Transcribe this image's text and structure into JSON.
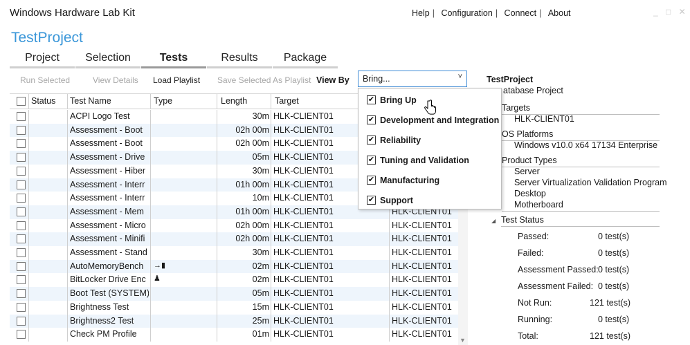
{
  "app": {
    "title": "Windows Hardware Lab Kit",
    "links": [
      "Help",
      "Configuration",
      "Connect",
      "About"
    ],
    "separator": "|",
    "window_controls": "_ □ ✕",
    "project": "TestProject"
  },
  "tabs": [
    {
      "label": "Project",
      "active": false
    },
    {
      "label": "Selection",
      "active": false
    },
    {
      "label": "Tests",
      "active": true
    },
    {
      "label": "Results",
      "active": false
    },
    {
      "label": "Package",
      "active": false
    }
  ],
  "toolbar": {
    "run_selected": "Run Selected",
    "view_details": "View Details",
    "load_playlist": "Load Playlist",
    "save_playlist": "Save Selected As Playlist",
    "view_by_label": "View By",
    "dropdown_value": "Bring...",
    "dropdown_chevron": "˅"
  },
  "grid": {
    "columns": [
      "Status",
      "Test Name",
      "Type",
      "Length",
      "Target"
    ],
    "rows": [
      {
        "name": "ACPI Logo Test",
        "type_icon": "",
        "length": "30m",
        "target": "HLK-CLIENT01",
        "target2": ""
      },
      {
        "name": "Assessment - Boot",
        "type_icon": "",
        "length": "02h 00m",
        "target": "HLK-CLIENT01",
        "target2": ""
      },
      {
        "name": "Assessment - Boot",
        "type_icon": "",
        "length": "02h 00m",
        "target": "HLK-CLIENT01",
        "target2": ""
      },
      {
        "name": "Assessment - Drive",
        "type_icon": "",
        "length": "05m",
        "target": "HLK-CLIENT01",
        "target2": ""
      },
      {
        "name": "Assessment - Hiber",
        "type_icon": "",
        "length": "30m",
        "target": "HLK-CLIENT01",
        "target2": ""
      },
      {
        "name": "Assessment - Interr",
        "type_icon": "",
        "length": "01h 00m",
        "target": "HLK-CLIENT01",
        "target2": ""
      },
      {
        "name": "Assessment - Interr",
        "type_icon": "",
        "length": "10m",
        "target": "HLK-CLIENT01",
        "target2": ""
      },
      {
        "name": "Assessment - Mem",
        "type_icon": "",
        "length": "01h 00m",
        "target": "HLK-CLIENT01",
        "target2": "HLK-CLIENT01"
      },
      {
        "name": "Assessment - Micro",
        "type_icon": "",
        "length": "02h 00m",
        "target": "HLK-CLIENT01",
        "target2": "HLK-CLIENT01"
      },
      {
        "name": "Assessment - Minifi",
        "type_icon": "",
        "length": "02h 00m",
        "target": "HLK-CLIENT01",
        "target2": "HLK-CLIENT01"
      },
      {
        "name": "Assessment - Stand",
        "type_icon": "",
        "length": "30m",
        "target": "HLK-CLIENT01",
        "target2": "HLK-CLIENT01"
      },
      {
        "name": "AutoMemoryBench",
        "type_icon": "→▮",
        "length": "02m",
        "target": "HLK-CLIENT01",
        "target2": "HLK-CLIENT01"
      },
      {
        "name": "BitLocker Drive Enc",
        "type_icon": "♟",
        "length": "02m",
        "target": "HLK-CLIENT01",
        "target2": "HLK-CLIENT01"
      },
      {
        "name": "Boot Test (SYSTEM)",
        "type_icon": "",
        "length": "05m",
        "target": "HLK-CLIENT01",
        "target2": "HLK-CLIENT01"
      },
      {
        "name": "Brightness Test",
        "type_icon": "",
        "length": "15m",
        "target": "HLK-CLIENT01",
        "target2": "HLK-CLIENT01"
      },
      {
        "name": "Brightness2 Test",
        "type_icon": "",
        "length": "25m",
        "target": "HLK-CLIENT01",
        "target2": "HLK-CLIENT01"
      },
      {
        "name": "Check PM Profile",
        "type_icon": "",
        "length": "01m",
        "target": "HLK-CLIENT01",
        "target2": "HLK-CLIENT01"
      }
    ]
  },
  "view_by_menu": {
    "items": [
      {
        "label": "Bring Up",
        "checked": true,
        "check": "✔"
      },
      {
        "label": "Development and Integration",
        "checked": true,
        "check": "✔"
      },
      {
        "label": "Reliability",
        "checked": true,
        "check": "✔"
      },
      {
        "label": "Tuning and Validation",
        "checked": true,
        "check": "✔"
      },
      {
        "label": "Manufacturing",
        "checked": true,
        "check": "✔"
      },
      {
        "label": "Support",
        "checked": true,
        "check": "✔"
      }
    ]
  },
  "details": {
    "title": "TestProject",
    "subtitle_visible": "atabase Project",
    "targets_label": "Targets",
    "target": "HLK-CLIENT01",
    "os_label": "OS Platforms",
    "os": "Windows v10.0 x64 17134 Enterprise",
    "product_types_label": "Product Types",
    "product_types": [
      "Server",
      "Server Virtualization Validation Program",
      "Desktop",
      "Motherboard"
    ],
    "test_status_label": "Test Status",
    "status": [
      {
        "label": "Passed:",
        "value": "0 test(s)"
      },
      {
        "label": "Failed:",
        "value": "0 test(s)"
      },
      {
        "label": "Assessment Passed:",
        "value": "0 test(s)"
      },
      {
        "label": "Assessment Failed:",
        "value": "0 test(s)"
      },
      {
        "label": "Not Run:",
        "value": "121 test(s)"
      },
      {
        "label": "Running:",
        "value": "0 test(s)"
      },
      {
        "label": "Total:",
        "value": "121 test(s)"
      }
    ]
  }
}
